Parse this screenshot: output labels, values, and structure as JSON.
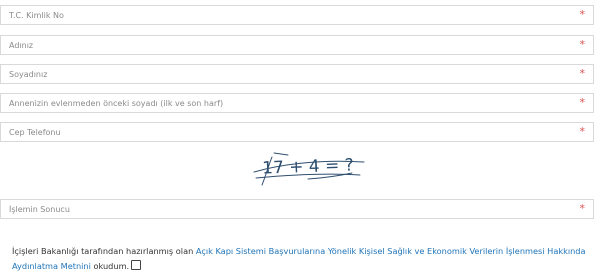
{
  "form": {
    "fields": [
      {
        "placeholder": "T.C. Kimlik No",
        "required_mark": "*"
      },
      {
        "placeholder": "Adınız",
        "required_mark": "*"
      },
      {
        "placeholder": "Soyadınız",
        "required_mark": "*"
      },
      {
        "placeholder": "Annenizin evlenmeden önceki soyadı (ilk ve son harf)",
        "required_mark": "*"
      },
      {
        "placeholder": "Cep Telefonu",
        "required_mark": "*"
      }
    ],
    "captcha": {
      "text": "17 + 4 = ?"
    },
    "result_field": {
      "placeholder": "İşlemin Sonucu",
      "required_mark": "*"
    }
  },
  "consent": {
    "prefix": "İçişleri Bakanlığı tarafından hazırlanmış olan ",
    "link_text": "Açık Kapı Sistemi Başvurularına Yönelik Kişisel Sağlık ve Ekonomik Verilerin İşlenmesi Hakkında Aydınlatma Metnini",
    "suffix": " okudum."
  },
  "colors": {
    "required": "#d9534f",
    "link": "#1f74b8",
    "captcha_ink": "#2f4f6f"
  }
}
